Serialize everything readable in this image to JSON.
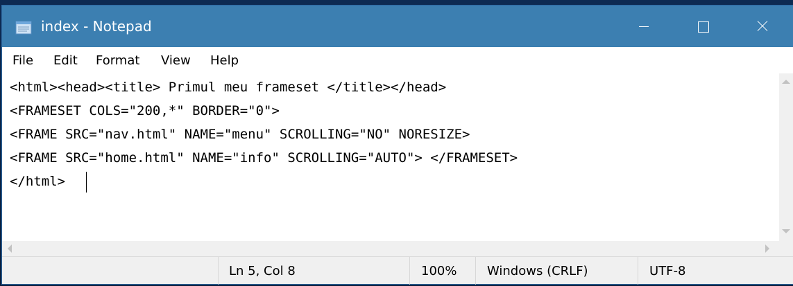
{
  "window": {
    "title": "index - Notepad"
  },
  "menu": {
    "items": [
      "File",
      "Edit",
      "Format",
      "View",
      "Help"
    ]
  },
  "editor": {
    "lines": [
      "<html><head><title> Primul meu frameset </title></head>",
      "<FRAMESET COLS=\"200,*\" BORDER=\"0\">",
      "<FRAME SRC=\"nav.html\" NAME=\"menu\" SCROLLING=\"NO\" NORESIZE>",
      "<FRAME SRC=\"home.html\" NAME=\"info\" SCROLLING=\"AUTO\"> </FRAMESET>",
      "</html>"
    ]
  },
  "status": {
    "position": "Ln 5, Col 8",
    "zoom": "100%",
    "line_ending": "Windows (CRLF)",
    "encoding": "UTF-8"
  },
  "icons": {
    "app": "notepad-icon",
    "minimize": "minimize-icon",
    "maximize": "maximize-icon",
    "close": "close-icon"
  },
  "colors": {
    "titlebar": "#3c7fb1",
    "background": "#0b2244"
  }
}
